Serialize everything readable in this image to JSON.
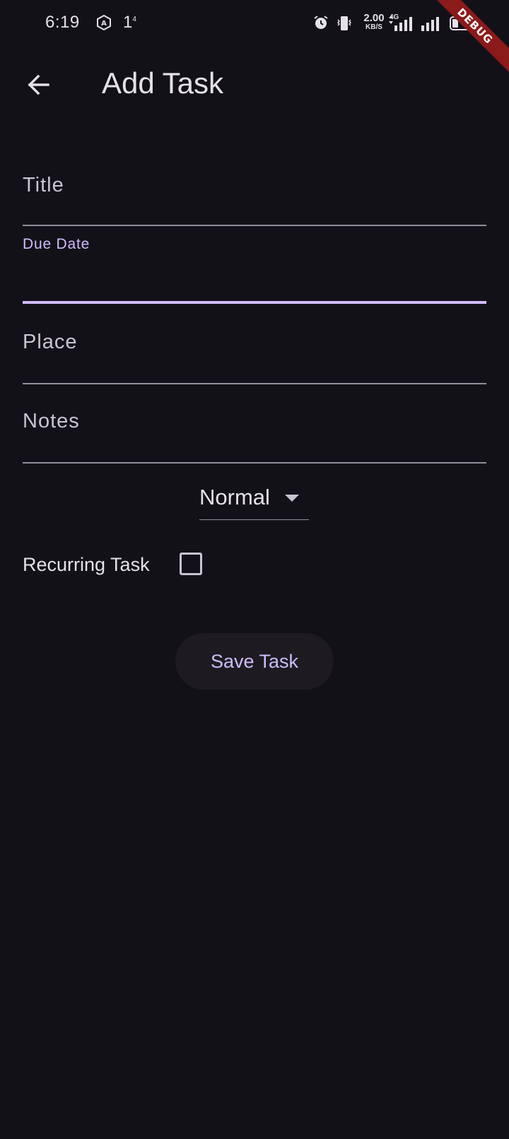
{
  "status_bar": {
    "time": "6:19",
    "notification_count": "1",
    "notification_sup": "4",
    "speed_value": "2.00",
    "speed_unit": "KB/S",
    "network_type": "4G",
    "icons": [
      "hexagon-a-icon",
      "alarm-icon",
      "vibrate-icon",
      "signal-bars-icon",
      "signal-bars-icon",
      "battery-icon"
    ]
  },
  "debug_banner": "DEBUG",
  "app_bar": {
    "title": "Add Task",
    "back_icon": "arrow-back-icon"
  },
  "form": {
    "title_label": "Title",
    "due_date_label": "Due Date",
    "place_label": "Place",
    "notes_label": "Notes",
    "priority_selected": "Normal",
    "recurring_label": "Recurring Task",
    "recurring_checked": false,
    "save_label": "Save Task"
  },
  "colors": {
    "background": "#131118",
    "accent": "#d0bcff",
    "text": "#e6e1e9",
    "muted": "#cac4d0",
    "debug": "#8b1a1a"
  }
}
